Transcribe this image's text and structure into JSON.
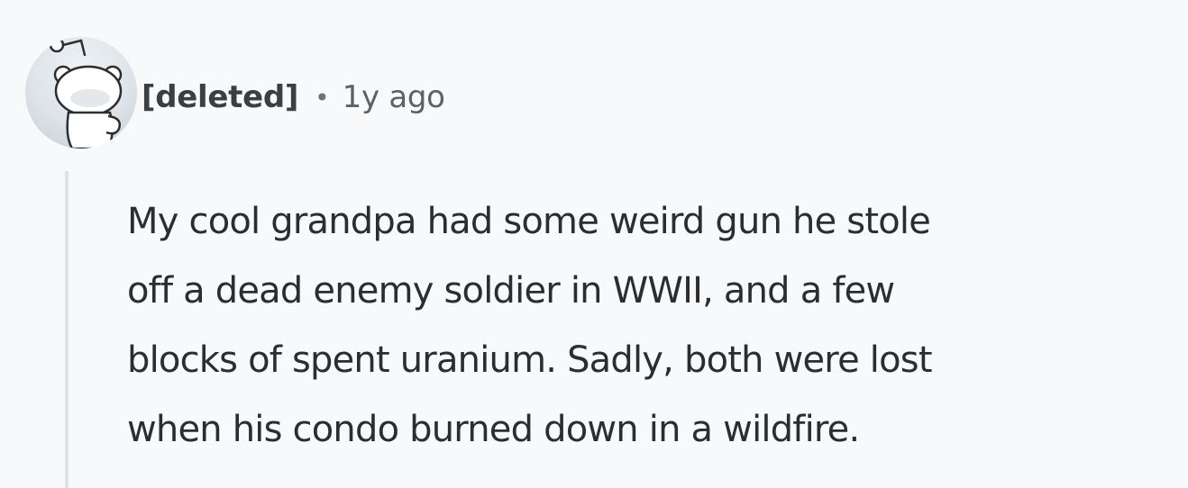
{
  "comment": {
    "author": "[deleted]",
    "separator": "•",
    "timestamp": "1y ago",
    "avatar_icon": "snoo-avatar-icon",
    "body_lines": [
      "My cool grandpa had some weird gun he stole",
      "off a dead enemy soldier in WWII, and a few",
      "blocks of spent uranium. Sadly, both were lost",
      "when his condo burned down in a wildfire."
    ]
  },
  "colors": {
    "background": "#f7f9fb",
    "thread_line": "#dbe2e8",
    "text": "#2a2e31"
  }
}
